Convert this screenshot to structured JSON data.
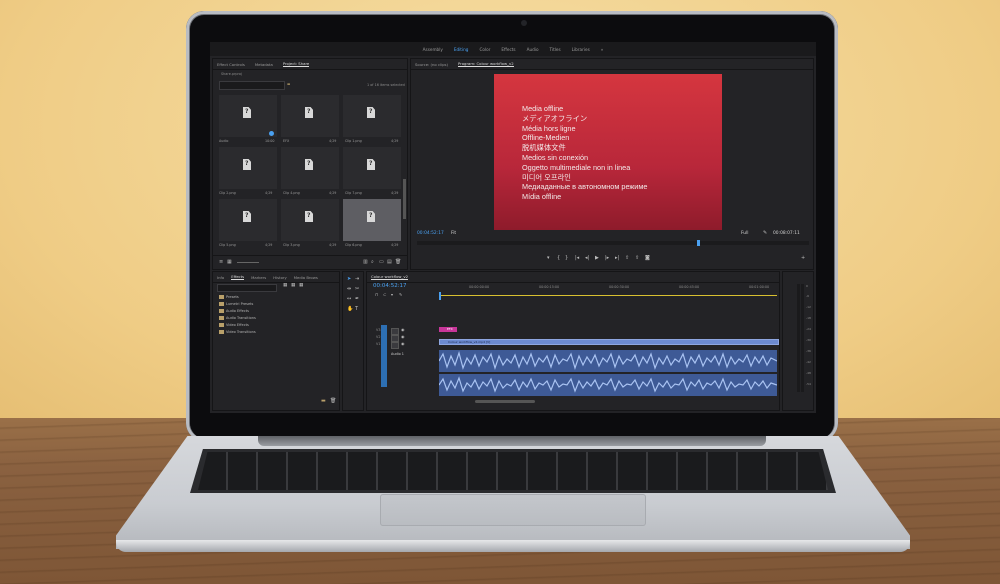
{
  "workspace_tabs": [
    {
      "label": "Assembly",
      "active": false
    },
    {
      "label": "Editing",
      "active": true
    },
    {
      "label": "Color",
      "active": false
    },
    {
      "label": "Effects",
      "active": false
    },
    {
      "label": "Audio",
      "active": false
    },
    {
      "label": "Titles",
      "active": false
    },
    {
      "label": "Libraries",
      "active": false
    }
  ],
  "workspace_more": "»",
  "project_panel": {
    "tabs": [
      {
        "label": "Effect Controls",
        "active": false
      },
      {
        "label": "Metadata",
        "active": false
      },
      {
        "label": "Project: Share",
        "active": true
      }
    ],
    "project_file": "Share.prproj",
    "items_selected": "1 of 16 items selected",
    "items": [
      {
        "label": "Audio",
        "duration": "10:00"
      },
      {
        "label": "EFX",
        "duration": "4;29"
      },
      {
        "label": "Clip 1.png",
        "duration": "4;29"
      },
      {
        "label": "Clip 2.png",
        "duration": "4;29"
      },
      {
        "label": "Clip 4.png",
        "duration": "4;29"
      },
      {
        "label": "Clip 7.png",
        "duration": "4;29"
      },
      {
        "label": "Clip 5.png",
        "duration": "4;29"
      },
      {
        "label": "Clip 3.png",
        "duration": "4;29"
      },
      {
        "label": "Clip 6.png",
        "duration": "4;29"
      }
    ]
  },
  "effects_panel": {
    "tabs": [
      {
        "label": "Info",
        "active": false
      },
      {
        "label": "Effects",
        "active": true
      },
      {
        "label": "Markers",
        "active": false
      },
      {
        "label": "History",
        "active": false
      },
      {
        "label": "Media Brows",
        "active": false
      }
    ],
    "tree": [
      "Presets",
      "Lumetri Presets",
      "Audio Effects",
      "Audio Transitions",
      "Video Effects",
      "Video Transitions"
    ]
  },
  "monitor": {
    "source_tab": "Source: (no clips)",
    "program_tab": "Program: Colour workflow_v2",
    "offline_lines": [
      "Media offline",
      "メディアオフライン",
      "Média hors ligne",
      "Offline-Medien",
      "脱机媒体文件",
      "Medios sin conexión",
      "Oggetto multimediale non in linea",
      "미디어 오프라인",
      "Медиаданные в автономном режиме",
      "Mídia offline"
    ],
    "current_timecode": "00:04:52:17",
    "fit": "Fit",
    "resolution": "Full",
    "duration": "00:08:07:11"
  },
  "timeline": {
    "tab": "Colour workflow_v2",
    "timecode": "00:04:52:17",
    "ruler": [
      "00:00:00:00",
      "00:00:15:00",
      "00:00:30:00",
      "00:00:45:00",
      "00:01:00:00"
    ],
    "video_clip": "Colour workflow_v2.mp4 [V]",
    "fx_clip": "EFX",
    "track_labels": [
      "V3",
      "V2",
      "V1",
      "A1",
      "A2",
      "A3"
    ],
    "audio_label": "Audio 1"
  },
  "meters": [
    "0",
    "-6",
    "-12",
    "-18",
    "-24",
    "-30",
    "-36",
    "-42",
    "-48",
    "-54"
  ],
  "colors": {
    "accent": "#4aa0f0",
    "offline_red": "#c22d3b",
    "clip_blue": "#6c8ad0"
  }
}
